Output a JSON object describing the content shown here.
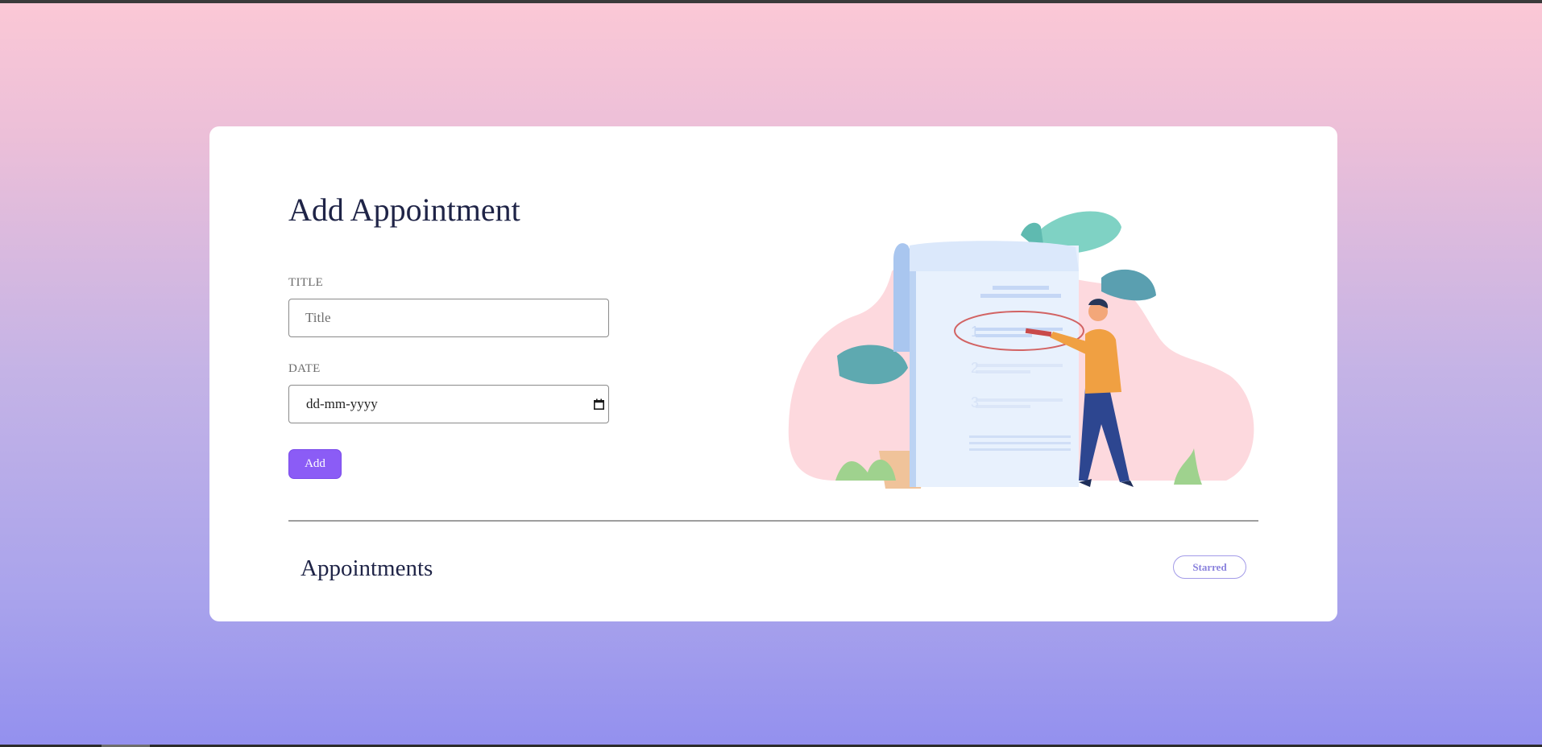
{
  "form": {
    "heading": "Add Appointment",
    "title_label": "TITLE",
    "title_placeholder": "Title",
    "date_label": "DATE",
    "date_value": "dd-mm-yyyy",
    "add_label": "Add"
  },
  "list": {
    "heading": "Appointments",
    "starred_label": "Starred"
  },
  "illustration": {
    "list_numbers": [
      "1",
      "2",
      "3"
    ]
  },
  "colors": {
    "accent": "#8b5cf6",
    "heading": "#1f2447",
    "starred": "#8a82dd"
  },
  "icons": {
    "date_picker": "calendar-icon"
  }
}
